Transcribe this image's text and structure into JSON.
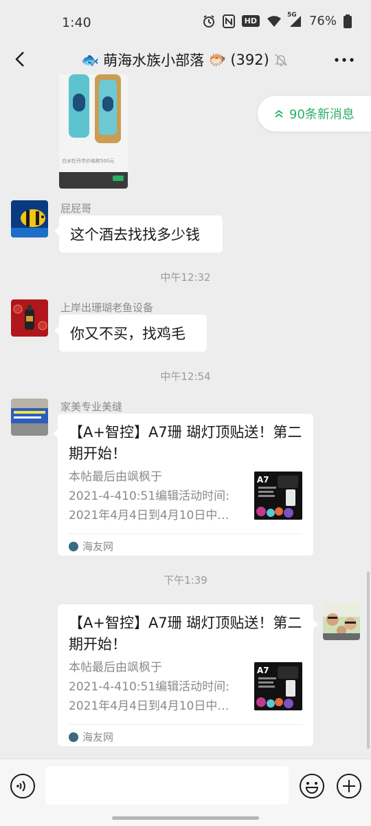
{
  "status_bar": {
    "time": "1:40",
    "battery": "76%",
    "network": "5G",
    "hd": "HD",
    "icons": [
      "alarm-icon",
      "nfc-icon",
      "hd-icon",
      "wifi-icon",
      "signal-icon",
      "battery-icon"
    ]
  },
  "nav": {
    "title_emoji_left": "🐟",
    "title": "萌海水族小部落",
    "title_emoji_right": "🐡",
    "member_count": "(392)",
    "icons": [
      "back-icon",
      "mute-icon",
      "more-icon"
    ]
  },
  "new_messages": {
    "label": "90条新消息",
    "icon": "double-chevron-up-icon"
  },
  "image_message": {
    "caption": "白水牡丹市价格称500元"
  },
  "messages": [
    {
      "sender": "屁屁哥",
      "text": "这个酒去找找多少钱"
    },
    {
      "sender": "上岸出珊瑚老鱼设备",
      "text": "你又不买，找鸡毛"
    }
  ],
  "time_separators": [
    "中午12:32",
    "中午12:54",
    "下午1:39"
  ],
  "link_cards": [
    {
      "sender": "家美专业美缝",
      "title": "【A+智控】A7珊 瑚灯顶贴送！第二期开始！",
      "desc_lines": [
        "本帖最后由飒枫于",
        "2021-4-410:51编辑活动时间:",
        "2021年4月4日到4月10日中…"
      ],
      "thumb_label": "A7",
      "source": "海友网"
    },
    {
      "sender": "",
      "title": "【A+智控】A7珊 瑚灯顶贴送！第二期开始！",
      "desc_lines": [
        "本帖最后由飒枫于",
        "2021-4-410:51编辑活动时间:",
        "2021年4月4日到4月10日中…"
      ],
      "thumb_label": "A7",
      "source": "海友网"
    }
  ],
  "input_bar": {
    "placeholder": "",
    "icons": [
      "voice-icon",
      "emoji-icon",
      "plus-icon"
    ]
  },
  "colors": {
    "accent_green": "#2aae67",
    "background": "#ededed",
    "bubble": "#ffffff"
  }
}
